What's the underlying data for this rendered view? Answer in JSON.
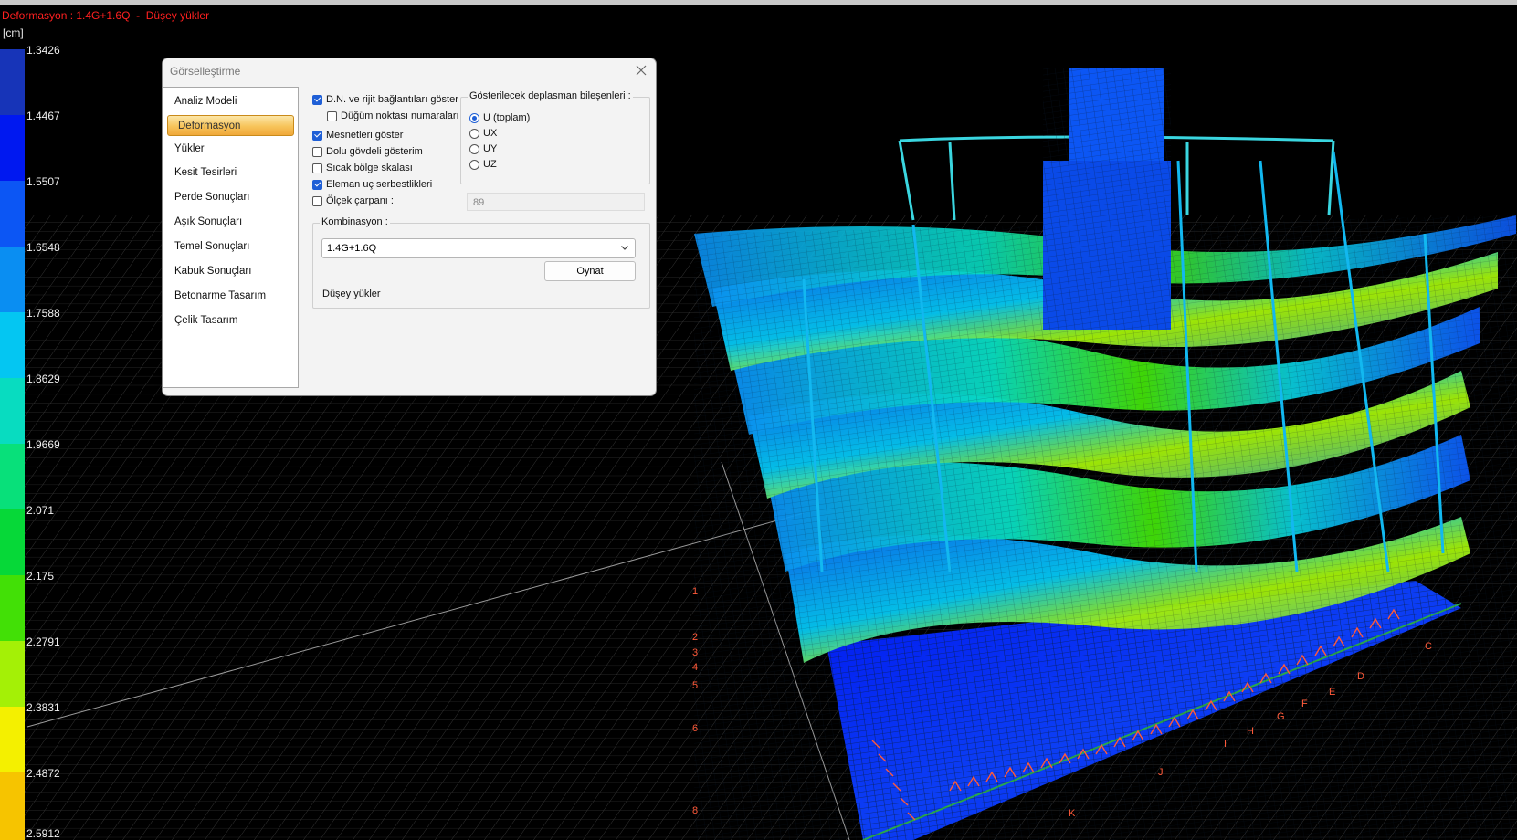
{
  "header": {
    "title": "Deformasyon : 1.4G+1.6Q  -  Düşey yükler",
    "unit": "[cm]"
  },
  "legend": {
    "ticks": [
      "1.3426",
      "1.4467",
      "1.5507",
      "1.6548",
      "1.7588",
      "1.8629",
      "1.9669",
      "2.071",
      "2.175",
      "2.2791",
      "2.3831",
      "2.4872",
      "2.5912"
    ],
    "colors": [
      "#1734b8",
      "#0018f0",
      "#0c56f4",
      "#0a8ef2",
      "#04c6f2",
      "#08dcc0",
      "#08e07a",
      "#06d838",
      "#42e006",
      "#a4f006",
      "#f4f000",
      "#f6c400",
      "#f5a000"
    ]
  },
  "dialog": {
    "title": "Görselleştirme",
    "close_icon": "close-icon",
    "nav": [
      {
        "label": "Analiz Modeli"
      },
      {
        "label": "Deformasyon",
        "active": true
      },
      {
        "label": "Yükler"
      },
      {
        "label": "Kesit Tesirleri"
      },
      {
        "label": "Perde Sonuçları"
      },
      {
        "label": "Aşık Sonuçları"
      },
      {
        "label": "Temel Sonuçları"
      },
      {
        "label": "Kabuk Sonuçları"
      },
      {
        "label": "Betonarme Tasarım"
      },
      {
        "label": "Çelik Tasarım"
      }
    ],
    "options": {
      "show_nodes": {
        "label": "D.N. ve rijit bağlantıları göster",
        "checked": true
      },
      "node_numbers": {
        "label": "Düğüm noktası numaraları",
        "checked": false
      },
      "show_supports": {
        "label": "Mesnetleri göster",
        "checked": true
      },
      "solid_view": {
        "label": "Dolu gövdeli gösterim",
        "checked": false
      },
      "hot_zone_scale": {
        "label": "Sıcak bölge skalası",
        "checked": false
      },
      "end_releases": {
        "label": "Eleman uç serbestlikleri",
        "checked": true
      },
      "scale_factor": {
        "label": "Ölçek çarpanı :",
        "checked": false,
        "value": "89"
      }
    },
    "displacement": {
      "label": "Gösterilecek deplasman bileşenleri :",
      "choices": [
        {
          "label": "U (toplam)",
          "selected": true
        },
        {
          "label": "UX",
          "selected": false
        },
        {
          "label": "UY",
          "selected": false
        },
        {
          "label": "UZ",
          "selected": false
        }
      ]
    },
    "combination": {
      "label": "Kombinasyon :",
      "selected": "1.4G+1.6Q",
      "play_label": "Oynat",
      "description": "Düşey yükler"
    }
  },
  "viewport": {
    "axis_labels": [
      "1",
      "2",
      "3",
      "4",
      "5",
      "6",
      "8",
      "C",
      "D",
      "E",
      "F",
      "G",
      "H",
      "I",
      "J",
      "K"
    ]
  }
}
